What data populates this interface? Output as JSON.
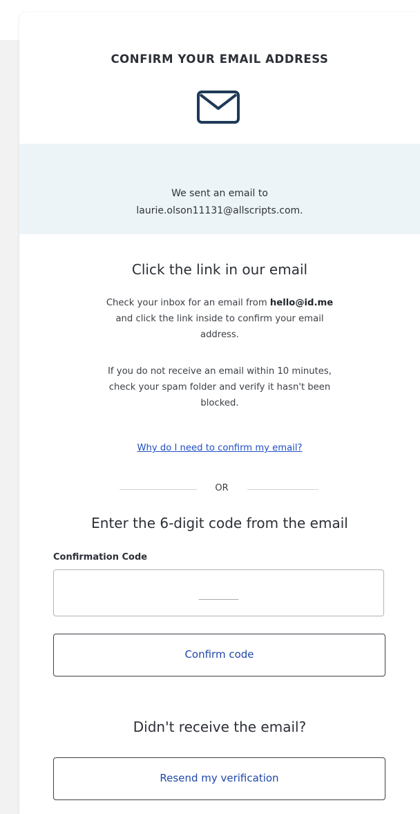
{
  "header": {
    "title": "CONFIRM YOUR EMAIL ADDRESS",
    "icon": "envelope-icon"
  },
  "banner": {
    "line1": "We sent an email to",
    "email": "laurie.olson11131@allscripts.com."
  },
  "link_section": {
    "title": "Click the link in our email",
    "para1_line1_prefix": "Check your inbox for an email from ",
    "para1_sender": "hello@id.me",
    "para1_line2": "and click the link inside to confirm your email",
    "para1_line3": "address.",
    "para2_line1": "If you do not receive an email within 10 minutes,",
    "para2_line2": "check your spam folder and verify it hasn't been",
    "para2_line3": "blocked.",
    "help_link": "Why do I need to confirm my email?"
  },
  "divider": {
    "text": "OR"
  },
  "code_section": {
    "title": "Enter the 6-digit code from the email",
    "label": "Confirmation Code",
    "placeholder": "______",
    "confirm_button": "Confirm code"
  },
  "resend_section": {
    "title": "Didn't receive the email?",
    "resend_button": "Resend my verification"
  },
  "colors": {
    "banner_bg": "#edf4f8",
    "icon": "#1f3a57",
    "link": "#1f4fc2",
    "button_text": "#1f47a8"
  }
}
